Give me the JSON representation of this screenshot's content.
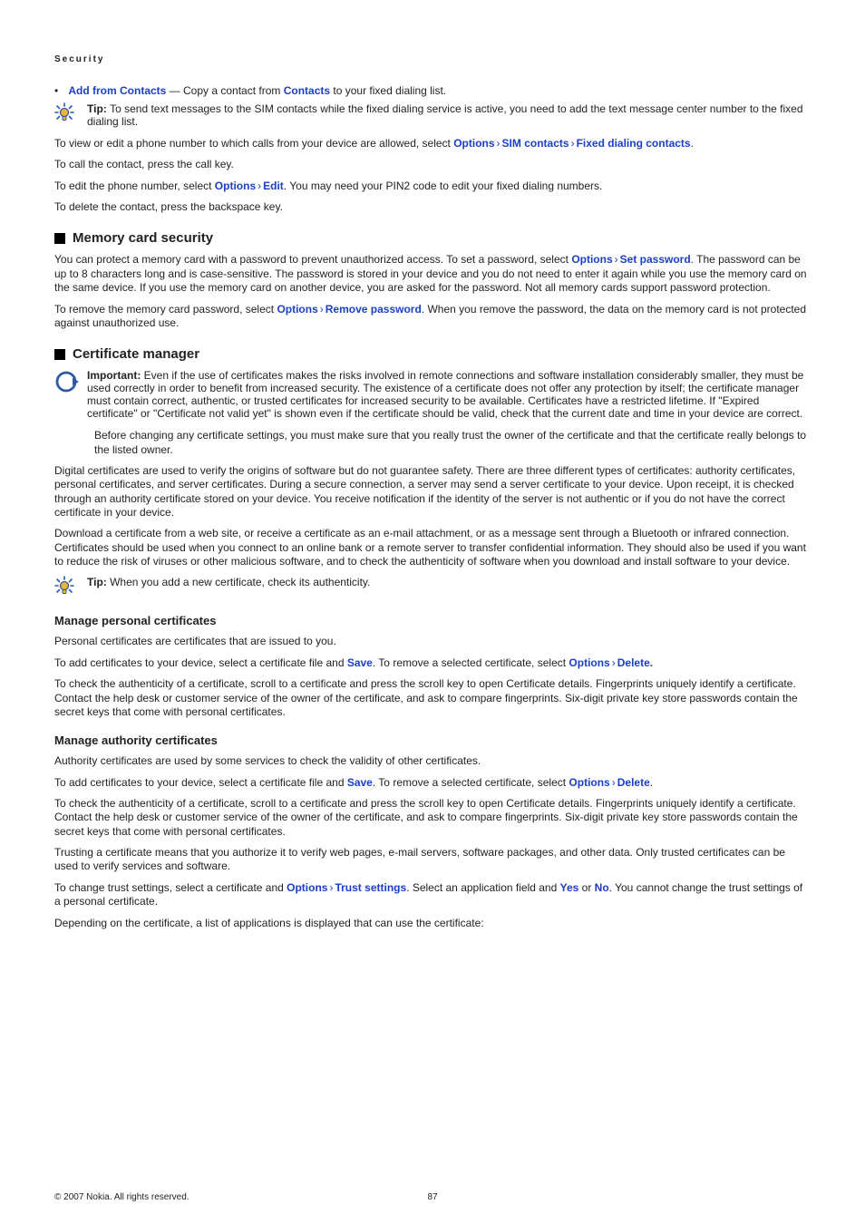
{
  "running_head": "Security",
  "bullet": {
    "label_part1": "Add from Contacts",
    "mid": " — Copy a contact from ",
    "label_part2": "Contacts",
    "tail": " to your fixed dialing list."
  },
  "tip1": {
    "lead": "Tip: ",
    "text": "To send text messages to the SIM contacts while the fixed dialing service is active, you need to add the text message center number to the fixed dialing list."
  },
  "view_para": {
    "pre": "To view or edit a phone number to which calls from your device are allowed, select ",
    "opt": "Options",
    "sim": "SIM contacts",
    "fixed": "Fixed dialing contacts",
    "end": "."
  },
  "call_para": "To call the contact, press the call key.",
  "edit_para": {
    "pre": "To edit the phone number, select ",
    "opt": "Options",
    "edit": "Edit",
    "post": ". You may need your PIN2 code to edit your fixed dialing numbers."
  },
  "delete_para": "To delete the contact, press the backspace key.",
  "h2_memory": "Memory card security",
  "memory_p1": {
    "pre": "You can protect a memory card with a password to prevent unauthorized access. To set a password, select ",
    "opt": "Options",
    "setpw": "Set password",
    "post": ". The password can be up to 8 characters long and is case-sensitive. The password is stored in your device and you do not need to enter it again while you use the memory card on the same device. If you use the memory card on another device, you are asked for the password. Not all memory cards support password protection."
  },
  "memory_p2": {
    "pre": "To remove the memory card password, select ",
    "opt": "Options",
    "rempw": "Remove password",
    "post": ". When you remove the password, the data on the memory card is not protected against unauthorized use."
  },
  "h2_cert": "Certificate manager",
  "important": {
    "lead": "Important:  ",
    "text": "Even if the use of certificates makes the risks involved in remote connections and software installation considerably smaller, they must be used correctly in order to benefit from increased security. The existence of a certificate does not offer any protection by itself; the certificate manager must contain correct, authentic, or trusted certificates for increased security to be available. Certificates have a restricted lifetime. If \"Expired certificate\" or \"Certificate not valid yet\" is shown even if the certificate should be valid, check that the current date and time in your device are correct."
  },
  "important_p2": "Before changing any certificate settings, you must make sure that you really trust the owner of the certificate and that the certificate really belongs to the listed owner.",
  "cert_p1": "Digital certificates are used to verify the origins of software but do not guarantee safety. There are three different types of certificates: authority certificates, personal certificates, and server certificates. During a secure connection, a server may send a server certificate to your device. Upon receipt, it is checked through an authority certificate stored on your device. You receive notification if the identity of the server is not authentic or if you do not have the correct certificate in your device.",
  "cert_p2": "Download a certificate from a web site, or receive a certificate as an e-mail attachment, or as a message sent through a Bluetooth or infrared connection. Certificates should be used when you connect to an online bank or a remote server to transfer confidential information. They should also be used if you want to reduce the risk of viruses or other malicious software, and to check the authenticity of software when you download and install software to your device.",
  "tip2": {
    "lead": "Tip: ",
    "text": "When you add a new certificate, check its authenticity."
  },
  "h3_personal": "Manage personal certificates",
  "personal_p1": "Personal certificates are certificates that are issued to you.",
  "personal_p2": {
    "pre": "To add certificates to your device, select a certificate file and ",
    "save": "Save",
    "mid": ". To remove a selected certificate, select ",
    "opt": "Options",
    "del": "Delete.",
    "end": ""
  },
  "personal_p3": "To check the authenticity of a certificate, scroll to a certificate and press the scroll key to open Certificate details. Fingerprints uniquely identify a certificate. Contact the help desk or customer service of the owner of the certificate, and ask to compare fingerprints. Six-digit private key store passwords contain the secret keys that come with personal certificates.",
  "h3_authority": "Manage authority certificates",
  "auth_p1": "Authority certificates are used by some services to check the validity of other certificates.",
  "auth_p2": {
    "pre": "To add certificates to your device, select a certificate file and ",
    "save": "Save",
    "mid": ". To remove a selected certificate, select ",
    "opt": "Options",
    "del": "Delete",
    "end": "."
  },
  "auth_p3": "To check the authenticity of a certificate, scroll to a certificate and press the scroll key to open Certificate details. Fingerprints uniquely identify a certificate. Contact the help desk or customer service of the owner of the certificate, and ask to compare fingerprints. Six-digit private key store passwords contain the secret keys that come with personal certificates.",
  "auth_p4": "Trusting a certificate means that you authorize it to verify web pages, e-mail servers, software packages, and other data. Only trusted certificates can be used to verify services and software.",
  "auth_p5": {
    "pre": "To change trust settings, select a certificate and ",
    "opt": "Options",
    "trust": "Trust settings",
    "mid": ". Select an application field and ",
    "yes": "Yes",
    "or": " or ",
    "no": "No",
    "post": ". You cannot change the trust settings of a personal certificate."
  },
  "auth_p6": "Depending on the certificate, a list of applications is displayed that can use the certificate:",
  "footer": {
    "copyright": "© 2007 Nokia. All rights reserved.",
    "page": "87"
  }
}
